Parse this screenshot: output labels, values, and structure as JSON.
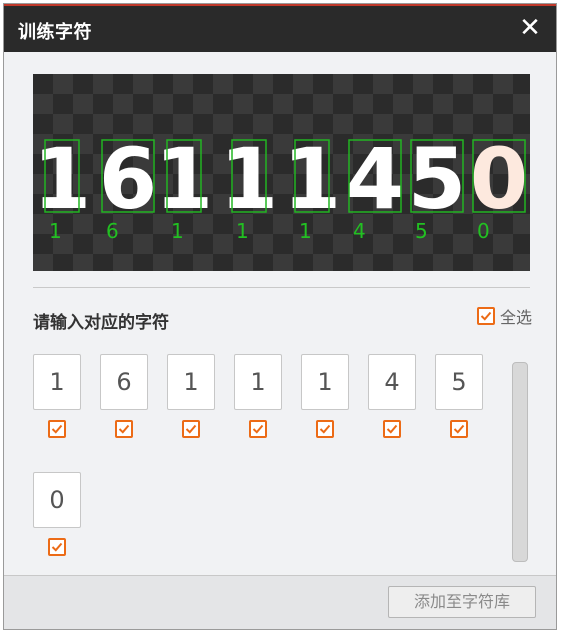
{
  "window": {
    "title": "训练字符"
  },
  "preview": {
    "characters": [
      "1",
      "6",
      "1",
      "1",
      "1",
      "4",
      "5",
      "0"
    ],
    "box_color": "#22b522",
    "label_color": "#22c022"
  },
  "section": {
    "prompt": "请输入对应的字符"
  },
  "select_all": {
    "label": "全选",
    "checked": true
  },
  "characters": [
    {
      "value": "1",
      "checked": true
    },
    {
      "value": "6",
      "checked": true
    },
    {
      "value": "1",
      "checked": true
    },
    {
      "value": "1",
      "checked": true
    },
    {
      "value": "1",
      "checked": true
    },
    {
      "value": "4",
      "checked": true
    },
    {
      "value": "5",
      "checked": true
    },
    {
      "value": "0",
      "checked": true
    }
  ],
  "footer": {
    "add_button": "添加至字符库"
  },
  "colors": {
    "accent": "#ec6b16",
    "titlebar": "#2a2a2a",
    "dialog_bg": "#f1f2f4"
  }
}
